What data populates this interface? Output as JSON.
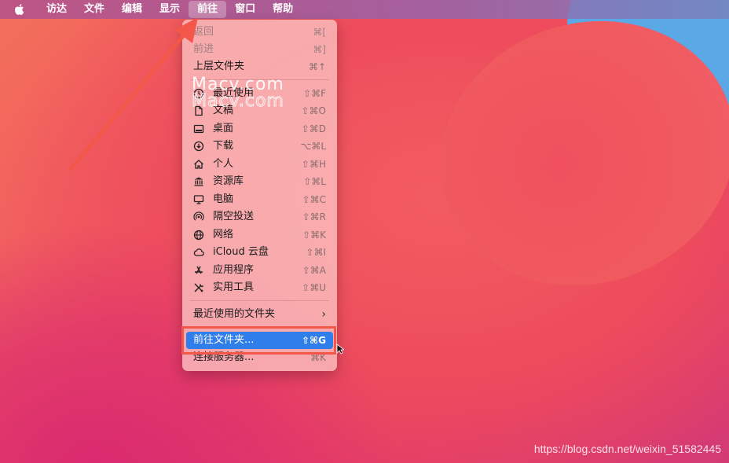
{
  "menubar": {
    "items": [
      "访达",
      "文件",
      "编辑",
      "显示",
      "前往",
      "窗口",
      "帮助"
    ]
  },
  "go_menu": {
    "back": {
      "label": "返回",
      "shortcut": "⌘["
    },
    "forward": {
      "label": "前进",
      "shortcut": "⌘]"
    },
    "enclosing": {
      "label": "上层文件夹",
      "shortcut": "⌘↑"
    },
    "items": [
      {
        "label": "最近使用",
        "shortcut": "⇧⌘F",
        "icon": "clock-icon"
      },
      {
        "label": "文稿",
        "shortcut": "⇧⌘O",
        "icon": "document-icon"
      },
      {
        "label": "桌面",
        "shortcut": "⇧⌘D",
        "icon": "desktop-icon"
      },
      {
        "label": "下载",
        "shortcut": "⌥⌘L",
        "icon": "download-icon"
      },
      {
        "label": "个人",
        "shortcut": "⇧⌘H",
        "icon": "home-icon"
      },
      {
        "label": "资源库",
        "shortcut": "⇧⌘L",
        "icon": "library-icon"
      },
      {
        "label": "电脑",
        "shortcut": "⇧⌘C",
        "icon": "computer-icon"
      },
      {
        "label": "隔空投送",
        "shortcut": "⇧⌘R",
        "icon": "airdrop-icon"
      },
      {
        "label": "网络",
        "shortcut": "⇧⌘K",
        "icon": "network-icon"
      },
      {
        "label": "iCloud 云盘",
        "shortcut": "⇧⌘I",
        "icon": "cloud-icon"
      },
      {
        "label": "应用程序",
        "shortcut": "⇧⌘A",
        "icon": "applications-icon"
      },
      {
        "label": "实用工具",
        "shortcut": "⇧⌘U",
        "icon": "utilities-icon"
      }
    ],
    "recent_folders": {
      "label": "最近使用的文件夹",
      "chevron": "›"
    },
    "goto_folder": {
      "label": "前往文件夹...",
      "shortcut": "⇧⌘G"
    },
    "connect_server": {
      "label": "连接服务器...",
      "shortcut": "⌘K"
    }
  },
  "watermark": "Macv.com",
  "credit": "https://blog.csdn.net/weixin_51582445",
  "colors": {
    "highlight": "#2f7ee9",
    "annotation": "#f2574a"
  }
}
